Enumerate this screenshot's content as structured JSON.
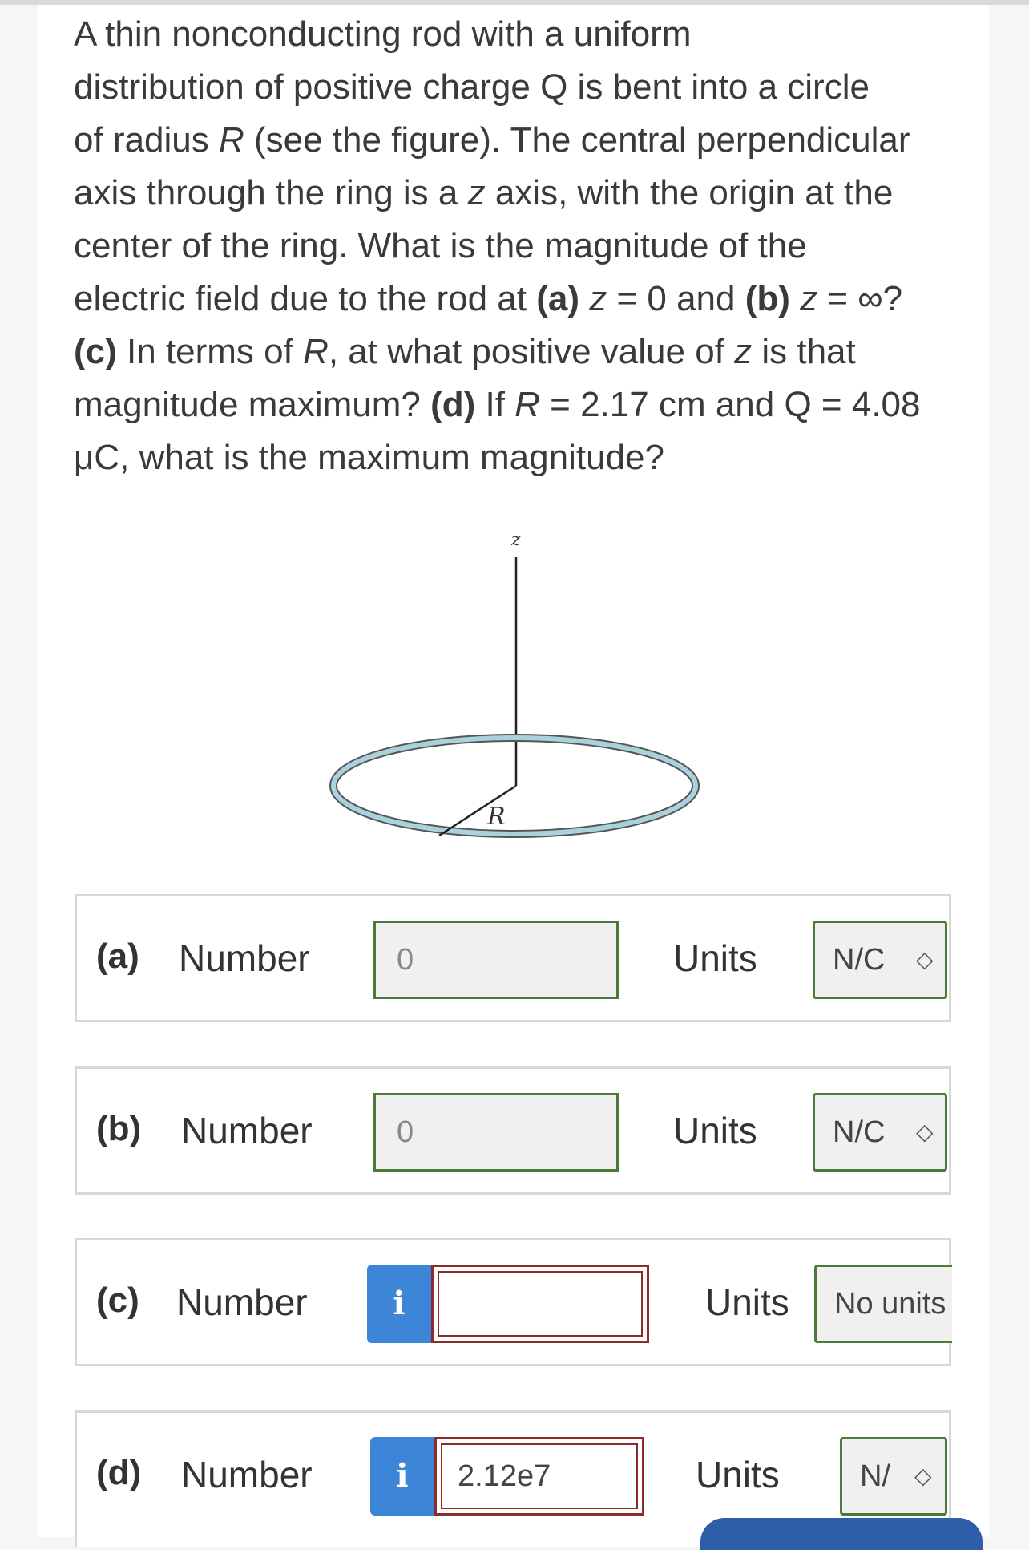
{
  "question": {
    "line1": "A thin nonconducting rod with a uniform",
    "line2": "distribution of positive charge Q is bent into a circle",
    "line3a": "of radius ",
    "line3R": "R",
    "line3b": " (see the figure). The central perpendicular",
    "line4a": "axis through the ring is a ",
    "line4z": "z",
    "line4b": " axis, with the origin at the",
    "line5": "center of the ring. What is the magnitude of the",
    "line6a": "electric field due to the rod at ",
    "line6pa": "(a)",
    "line6z1": " z",
    "line6b": " = 0 and ",
    "line6pb": "(b)",
    "line6z2": " z",
    "line6c": " = ∞?",
    "line7pc": "(c)",
    "line7a": " In terms of ",
    "line7R": "R",
    "line7b": ", at what positive value of ",
    "line7z": "z",
    "line7c": " is that",
    "line8a": "magnitude maximum? ",
    "line8pd": "(d)",
    "line8b": " If ",
    "line8R": "R",
    "line8c": " = 2.17 cm and Q = 4.08",
    "line9": "μC, what is the maximum magnitude?"
  },
  "figure": {
    "axis_label": "z",
    "radius_label": "R"
  },
  "answers": [
    {
      "part": "(a)",
      "number_label": "Number",
      "value": "0",
      "units_label": "Units",
      "unit": "N/C"
    },
    {
      "part": "(b)",
      "number_label": "Number",
      "value": "0",
      "units_label": "Units",
      "unit": "N/C"
    },
    {
      "part": "(c)",
      "number_label": "Number",
      "info": "i",
      "value": "",
      "units_label": "Units",
      "unit": "No units"
    },
    {
      "part": "(d)",
      "number_label": "Number",
      "info": "i",
      "value": "2.12e7",
      "units_label": "Units",
      "unit": "N/"
    }
  ],
  "colors": {
    "info_button": "#3d85d6",
    "correct_border": "#4b7a3a",
    "error_border": "#8b2b2b",
    "ring": "#a9d2dc"
  }
}
